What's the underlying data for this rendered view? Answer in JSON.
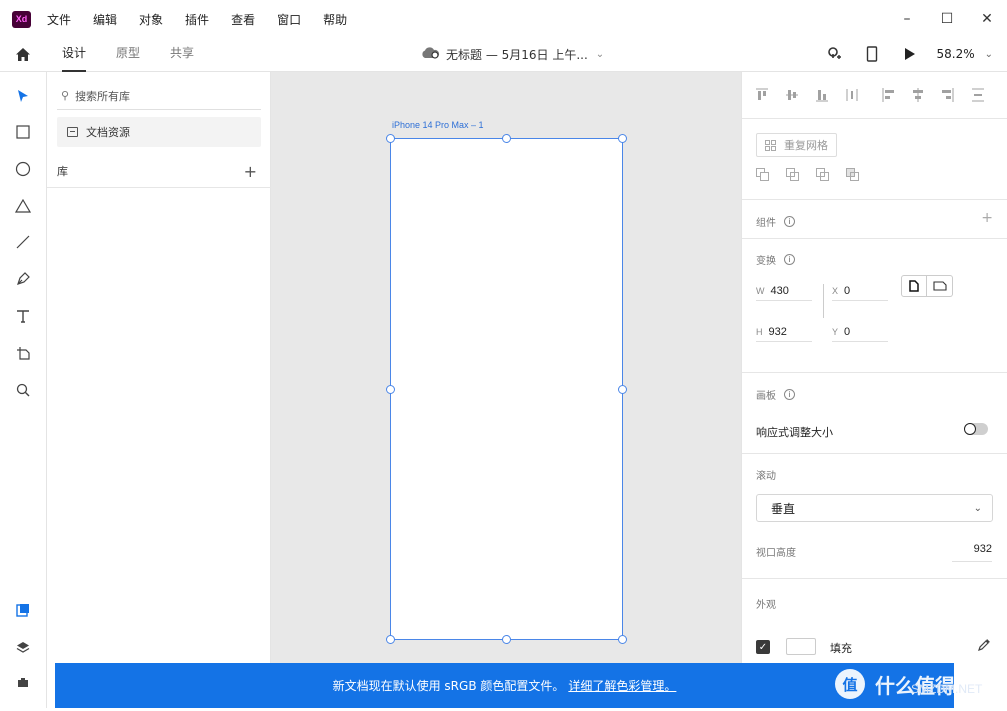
{
  "app": {
    "logo_text": "Xd"
  },
  "menu": [
    "文件",
    "编辑",
    "对象",
    "插件",
    "查看",
    "窗口",
    "帮助"
  ],
  "window_controls": {
    "minimize": "–",
    "maximize": "☐",
    "close": "✕"
  },
  "modes": [
    {
      "label": "设计",
      "active": true
    },
    {
      "label": "原型",
      "active": false
    },
    {
      "label": "共享",
      "active": false
    }
  ],
  "document": {
    "title": "无标题 — 5月16日 上午..."
  },
  "toolbar": {
    "zoom": "58.2%"
  },
  "library": {
    "search_placeholder": "搜索所有库",
    "document_assets": "文档资源",
    "libraries_label": "库"
  },
  "canvas": {
    "artboard_name": "iPhone 14 Pro Max – 1"
  },
  "inspector": {
    "repeat_grid": "重复网格",
    "component_title": "组件",
    "transform_title": "变换",
    "w_label": "W",
    "w_value": "430",
    "x_label": "X",
    "x_value": "0",
    "h_label": "H",
    "h_value": "932",
    "y_label": "Y",
    "y_value": "0",
    "artboard_title": "画板",
    "responsive_resize": "响应式调整大小",
    "responsive_on": false,
    "scroll_title": "滚动",
    "scroll_option": "垂直",
    "viewport_height_label": "视口高度",
    "viewport_height_value": "932",
    "appearance_title": "外观",
    "fill_label": "填充",
    "fill_color": "#FFFFFF"
  },
  "banner": {
    "message": "新文档现在默认使用 sRGB 颜色配置文件。",
    "link": "详细了解色彩管理。"
  },
  "watermark": {
    "text": "什么值得买",
    "sub": "SMZDM.NET",
    "badge": "值"
  },
  "colors": {
    "accent": "#1473E6",
    "selection": "#4A86E8",
    "canvas_bg": "#E8E8E8"
  }
}
